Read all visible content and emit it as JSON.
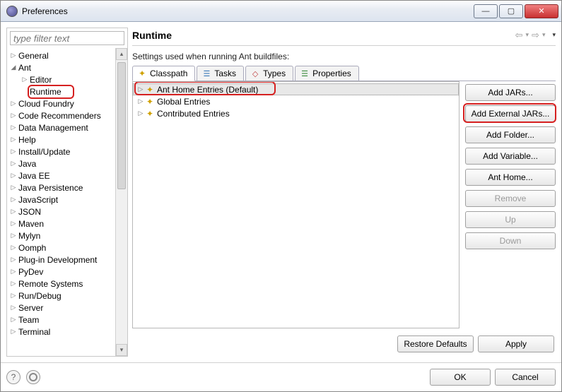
{
  "window": {
    "title": "Preferences"
  },
  "filter": {
    "placeholder": "type filter text"
  },
  "tree": [
    {
      "label": "General",
      "expand": "▷",
      "indent": 0
    },
    {
      "label": "Ant",
      "expand": "◢",
      "indent": 0
    },
    {
      "label": "Editor",
      "expand": "▷",
      "indent": 1
    },
    {
      "label": "Runtime",
      "expand": "",
      "indent": 1,
      "highlight": true
    },
    {
      "label": "Cloud Foundry",
      "expand": "▷",
      "indent": 0
    },
    {
      "label": "Code Recommenders",
      "expand": "▷",
      "indent": 0
    },
    {
      "label": "Data Management",
      "expand": "▷",
      "indent": 0
    },
    {
      "label": "Help",
      "expand": "▷",
      "indent": 0
    },
    {
      "label": "Install/Update",
      "expand": "▷",
      "indent": 0
    },
    {
      "label": "Java",
      "expand": "▷",
      "indent": 0
    },
    {
      "label": "Java EE",
      "expand": "▷",
      "indent": 0
    },
    {
      "label": "Java Persistence",
      "expand": "▷",
      "indent": 0
    },
    {
      "label": "JavaScript",
      "expand": "▷",
      "indent": 0
    },
    {
      "label": "JSON",
      "expand": "▷",
      "indent": 0
    },
    {
      "label": "Maven",
      "expand": "▷",
      "indent": 0
    },
    {
      "label": "Mylyn",
      "expand": "▷",
      "indent": 0
    },
    {
      "label": "Oomph",
      "expand": "▷",
      "indent": 0
    },
    {
      "label": "Plug-in Development",
      "expand": "▷",
      "indent": 0
    },
    {
      "label": "PyDev",
      "expand": "▷",
      "indent": 0
    },
    {
      "label": "Remote Systems",
      "expand": "▷",
      "indent": 0
    },
    {
      "label": "Run/Debug",
      "expand": "▷",
      "indent": 0
    },
    {
      "label": "Server",
      "expand": "▷",
      "indent": 0
    },
    {
      "label": "Team",
      "expand": "▷",
      "indent": 0
    },
    {
      "label": "Terminal",
      "expand": "▷",
      "indent": 0
    }
  ],
  "page": {
    "title": "Runtime",
    "description": "Settings used when running Ant buildfiles:"
  },
  "tabs": [
    {
      "label": "Classpath",
      "active": true
    },
    {
      "label": "Tasks",
      "active": false
    },
    {
      "label": "Types",
      "active": false
    },
    {
      "label": "Properties",
      "active": false
    }
  ],
  "entries": [
    {
      "label": "Ant Home Entries (Default)",
      "selected": true
    },
    {
      "label": "Global Entries",
      "selected": false
    },
    {
      "label": "Contributed Entries",
      "selected": false
    }
  ],
  "side_buttons": [
    {
      "label": "Add JARs...",
      "key": "add-jars",
      "disabled": false
    },
    {
      "label": "Add External JARs...",
      "key": "add-external-jars",
      "disabled": false,
      "highlight": true
    },
    {
      "label": "Add Folder...",
      "key": "add-folder",
      "disabled": false
    },
    {
      "label": "Add Variable...",
      "key": "add-variable",
      "disabled": false
    },
    {
      "label": "Ant Home...",
      "key": "ant-home",
      "disabled": false
    },
    {
      "label": "Remove",
      "key": "remove",
      "disabled": true
    },
    {
      "label": "Up",
      "key": "up",
      "disabled": true
    },
    {
      "label": "Down",
      "key": "down",
      "disabled": true
    }
  ],
  "footer": {
    "restore": "Restore Defaults",
    "apply": "Apply"
  },
  "bottom": {
    "ok": "OK",
    "cancel": "Cancel"
  }
}
